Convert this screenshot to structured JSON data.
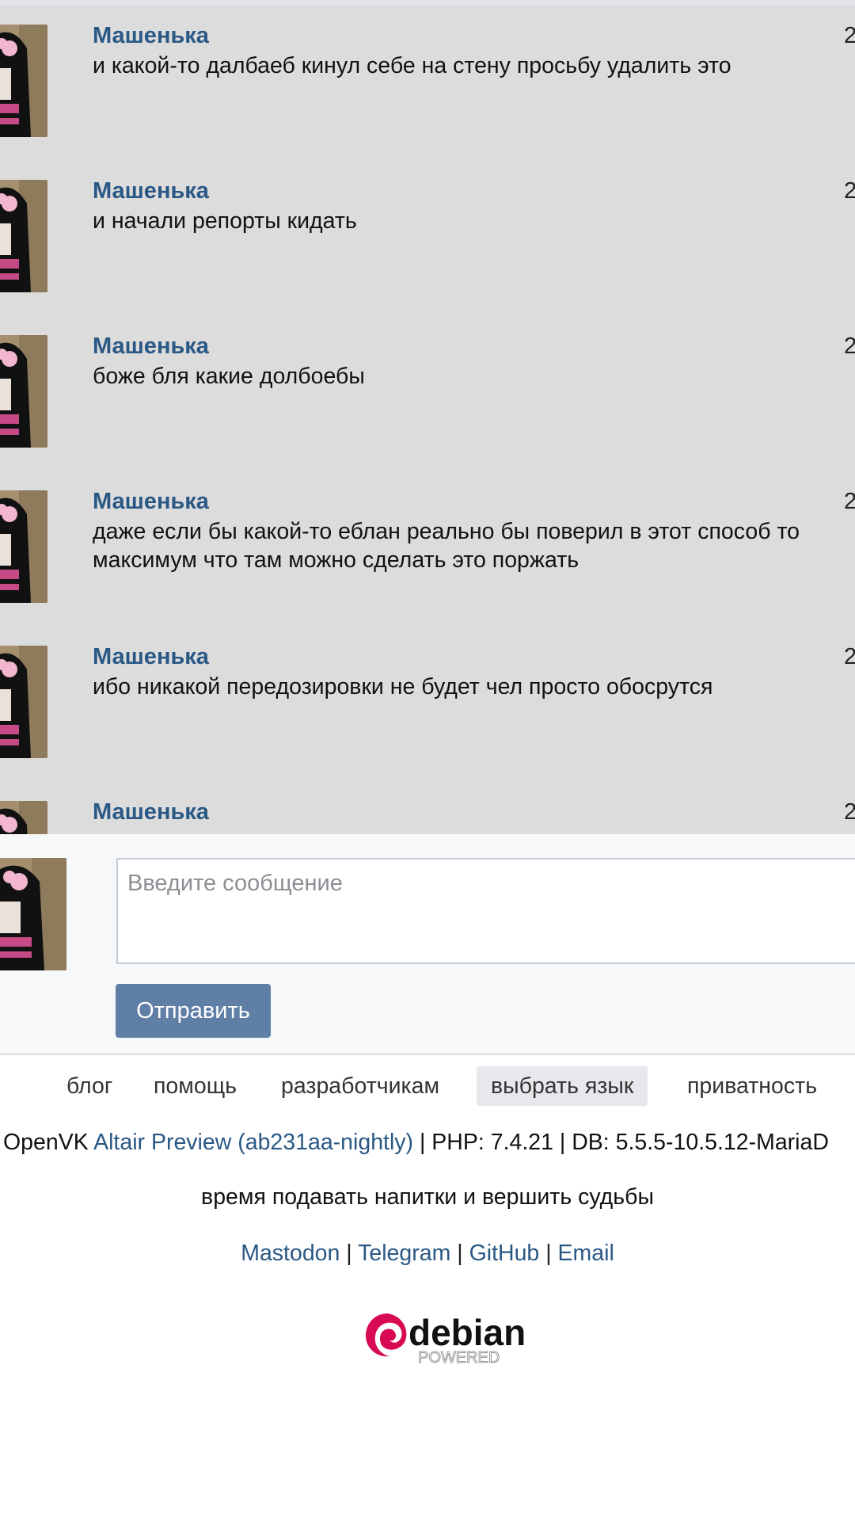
{
  "messages": [
    {
      "author": "Машенька",
      "time": "2",
      "text": "и какой-то далбаеб кинул себе на стену просьбу удалить это"
    },
    {
      "author": "Машенька",
      "time": "2",
      "text": "и начали репорты кидать"
    },
    {
      "author": "Машенька",
      "time": "2",
      "text": "боже бля какие долбоебы"
    },
    {
      "author": "Машенька",
      "time": "2",
      "text": "даже если бы какой-то еблан реально бы поверил в этот способ то максимум что там можно сделать это поржать"
    },
    {
      "author": "Машенька",
      "time": "2",
      "text": "ибо никакой передозировки не будет чел просто обосрутся"
    },
    {
      "author": "Машенька",
      "time": "2",
      "text": ""
    }
  ],
  "composer": {
    "placeholder": "Введите сообщение",
    "send_label": "Отправить"
  },
  "footer": {
    "nav": [
      "блог",
      "помощь",
      "разработчикам",
      "выбрать язык",
      "приватность"
    ],
    "version_prefix": "OpenVK ",
    "version_link": "Altair Preview (ab231aa-nightly)",
    "version_suffix": " | PHP: 7.4.21 | DB: 5.5.5-10.5.12-MariaD",
    "tagline": "время подавать напитки и вершить судьбы",
    "social": [
      "Mastodon",
      "Telegram",
      "GitHub",
      "Email"
    ],
    "separator": " | ",
    "badge_word": "debian",
    "badge_sub": "POWERED"
  },
  "colors": {
    "author": "#2a5885",
    "messages_bg": "#dcdcdc",
    "button": "#5f7fa6",
    "debian_red": "#d70a53"
  }
}
